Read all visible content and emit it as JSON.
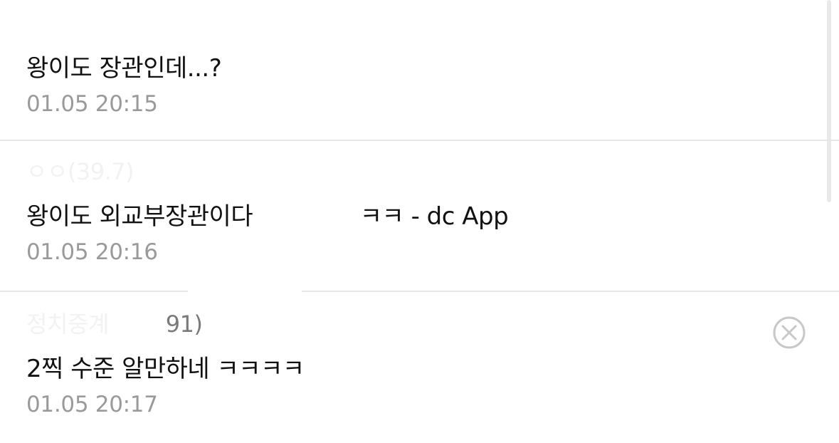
{
  "comments": [
    {
      "text": "왕이도 장관인데...?",
      "time": "01.05 20:15"
    },
    {
      "author_visible": "ㅇㅇ(39.7)",
      "text": "왕이도 외교부장관이다",
      "text_tail": "ㅋㅋ - dc App",
      "time": "01.05 20:16"
    },
    {
      "author_visible": "정치중계",
      "author_tail": "91)",
      "text": "2찍 수준 알만하네 ㅋㅋㅋㅋ",
      "time": "01.05 20:17"
    }
  ],
  "icons": {
    "close": "close-circle-icon"
  },
  "colors": {
    "text": "#111111",
    "time": "#9a9a9a",
    "divider": "#e6e6e6",
    "icon": "#c8c8c8"
  }
}
